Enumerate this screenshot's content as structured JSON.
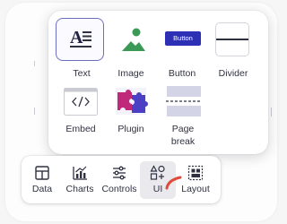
{
  "colors": {
    "accent": "#3b3fa8",
    "image_green": "#3a9a55",
    "button_fill": "#2d2fb5",
    "plugin_magenta": "#c0287a",
    "plugin_purple": "#4b3fc4",
    "annotation_red": "#e04a3a"
  },
  "insert_menu": {
    "items": [
      {
        "label": "Text",
        "icon": "text-block-icon",
        "active": true
      },
      {
        "label": "Image",
        "icon": "image-icon"
      },
      {
        "label": "Button",
        "icon": "button-icon",
        "button_text": "Button"
      },
      {
        "label": "Divider",
        "icon": "divider-icon"
      },
      {
        "label": "Embed",
        "icon": "embed-code-icon"
      },
      {
        "label": "Plugin",
        "icon": "puzzle-icon"
      },
      {
        "label": "Page break",
        "label_lines": [
          "Page",
          "break"
        ],
        "icon": "page-break-icon"
      }
    ]
  },
  "toolbar": {
    "items": [
      {
        "label": "Data",
        "icon": "table-icon"
      },
      {
        "label": "Charts",
        "icon": "chart-icon"
      },
      {
        "label": "Controls",
        "icon": "sliders-icon"
      },
      {
        "label": "UI",
        "icon": "shapes-icon",
        "selected": true
      },
      {
        "label": "Layout",
        "icon": "layout-grid-icon"
      }
    ]
  }
}
